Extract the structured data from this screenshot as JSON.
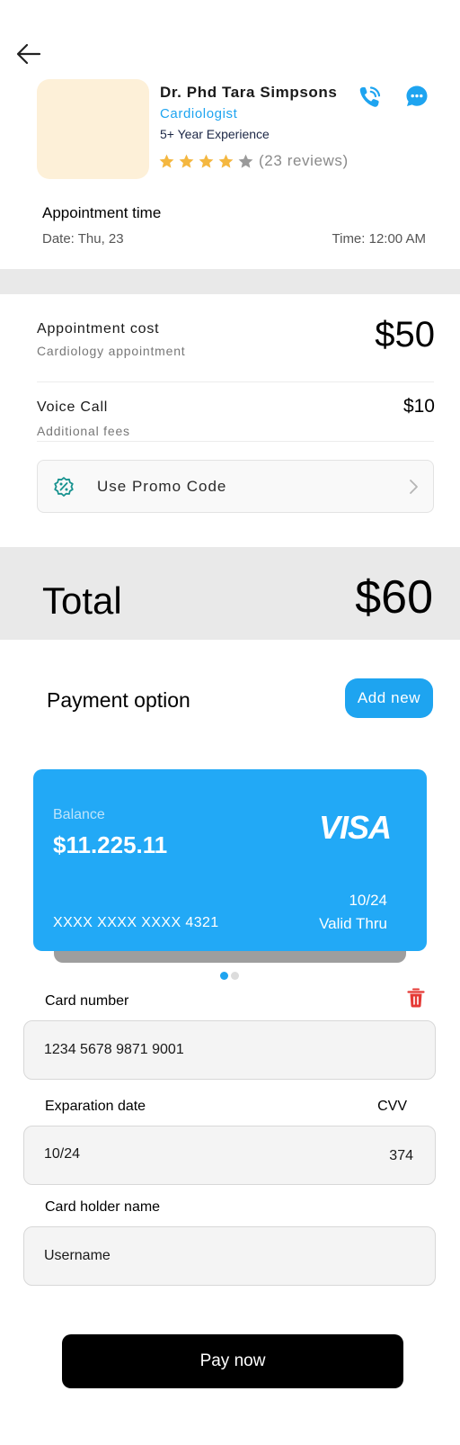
{
  "doctor": {
    "name": "Dr. Phd Tara Simpsons",
    "specialty": "Cardiologist",
    "experience": "5+ Year Experience",
    "rating": 4,
    "rating_max": 5,
    "reviews": "(23 reviews)"
  },
  "appointment": {
    "title": "Appointment time",
    "date": "Date:  Thu, 23",
    "time": "Time: 12:00 AM"
  },
  "costs": {
    "appointment_label": "Appointment cost",
    "appointment_sub": "Cardiology appointment",
    "appointment_value": "$50",
    "voice_label": "Voice Call",
    "voice_sub": "Additional fees",
    "voice_value": "$10",
    "promo_label": "Use Promo Code"
  },
  "total": {
    "label": "Total",
    "value": "$60"
  },
  "payment": {
    "title": "Payment option",
    "add_new": "Add new",
    "card": {
      "balance_label": "Balance",
      "balance": "$11.225.11",
      "brand": "VISA",
      "expiry": "10/24",
      "number": "XXXX XXXX XXXX 4321",
      "valid_thru": "Valid Thru"
    },
    "carousel": {
      "count": 2,
      "active_index": 0
    }
  },
  "form": {
    "card_number_label": "Card number",
    "card_number_value": "1234 5678 9871 9001",
    "expiration_label": "Exparation date",
    "expiration_value": "10/24",
    "cvv_label": "CVV",
    "cvv_value": "374",
    "holder_label": "Card holder name",
    "holder_value": "Username"
  },
  "pay_button": "Pay now",
  "colors": {
    "accent": "#1ea4f0",
    "card": "#22a9f6",
    "star": "#f4b740",
    "delete": "#e53935"
  }
}
